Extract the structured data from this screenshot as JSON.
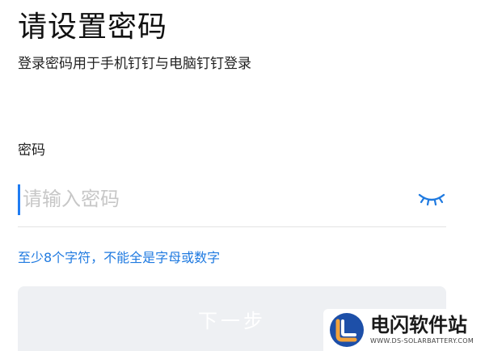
{
  "page": {
    "title": "请设置密码",
    "subtitle": "登录密码用于手机钉钉与电脑钉钉登录"
  },
  "password_field": {
    "label": "密码",
    "placeholder": "请输入密码",
    "value": "",
    "visibility_icon": "eye-closed-icon",
    "hint": "至少8个字符，不能全是字母或数字"
  },
  "next_button": {
    "label": "下一步",
    "enabled": false
  },
  "watermark": {
    "name": "电闪软件站",
    "url": "WWW.DS-SOLARBATTERY.COM"
  },
  "colors": {
    "accent": "#1f7ae0",
    "caret": "#1f7cf2",
    "disabled_button": "#eef0f3",
    "placeholder": "#c7c7c7",
    "divider": "#e3e3e3"
  }
}
